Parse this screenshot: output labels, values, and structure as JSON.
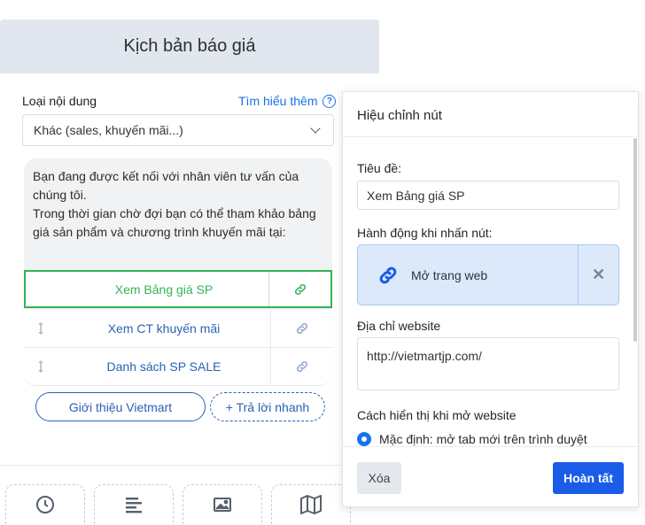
{
  "left_panel": {
    "header_title": "Kịch bản báo giá",
    "content_type_label": "Loại nội dung",
    "learn_more": "Tìm hiểu thêm",
    "content_type_value": "Khác (sales, khuyến mãi...)",
    "message_text": "Bạn đang được kết nối với nhân viên tư vấn của chúng tôi.\nTrong thời gian chờ đợi bạn có thể tham khảo bảng giá sản phẩm và chương trình khuyến mãi tại:",
    "buttons": [
      {
        "label": "Xem Bảng giá SP",
        "icon": "link-icon",
        "selected": true
      },
      {
        "label": "Xem CT khuyến mãi",
        "icon": "link-icon",
        "selected": false
      },
      {
        "label": "Danh sách SP SALE",
        "icon": "link-icon",
        "selected": false
      }
    ],
    "quick_replies": {
      "primary": "Giới thiệu Vietmart",
      "add": "+ Trả lời nhanh"
    },
    "toolbar_icons": [
      "clock-icon",
      "text-lines-icon",
      "image-icon",
      "map-icon"
    ]
  },
  "dialog": {
    "title": "Hiệu chỉnh nút",
    "title_field_label": "Tiêu đề:",
    "title_field_value": "Xem Bảng giá SP",
    "action_label": "Hành động khi nhấn nút:",
    "action_value": "Mở trang web",
    "website_label": "Địa chỉ website",
    "website_value": "http://vietmartjp.com/",
    "display_mode_label": "Cách hiển thị khi mở website",
    "display_mode_option": "Mặc định: mở tab mới trên trình duyệt",
    "delete_label": "Xóa",
    "done_label": "Hoàn tất"
  },
  "colors": {
    "accent": "#1a5ce8",
    "selected": "#34b455",
    "header_bg": "#e2e7ef",
    "action_bg": "#dbe9fb"
  }
}
